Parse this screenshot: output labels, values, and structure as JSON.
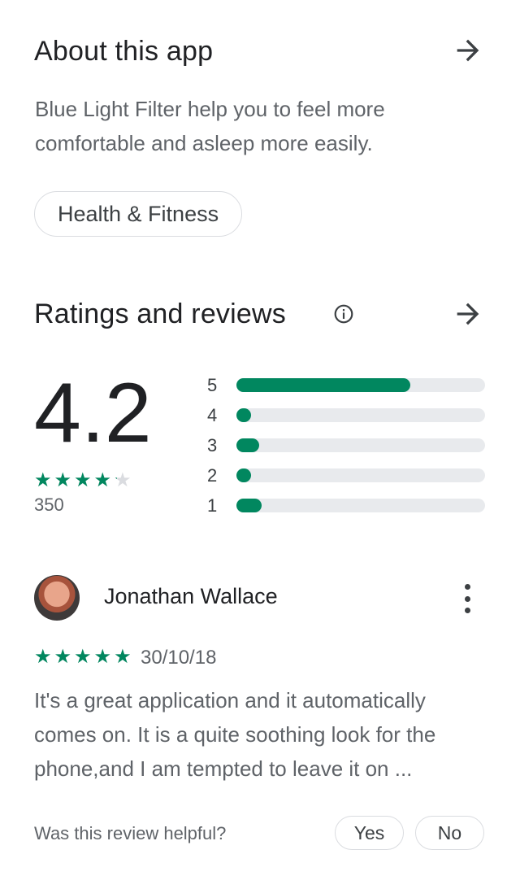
{
  "about": {
    "title": "About this app",
    "description": "Blue Light Filter help you to feel more comfortable and asleep more easily.",
    "category_chip": "Health & Fitness",
    "arrow_icon": "arrow-right-icon"
  },
  "ratings": {
    "title": "Ratings and reviews",
    "info_icon": "info-icon",
    "arrow_icon": "arrow-right-icon",
    "average": "4.2",
    "stars_value": 4.2,
    "count": "350",
    "histogram": [
      {
        "label": "5",
        "fraction": 0.7
      },
      {
        "label": "4",
        "fraction": 0.06
      },
      {
        "label": "3",
        "fraction": 0.09
      },
      {
        "label": "2",
        "fraction": 0.06
      },
      {
        "label": "1",
        "fraction": 0.1
      }
    ],
    "accent_color": "#01875f"
  },
  "review": {
    "author": "Jonathan Wallace",
    "rating": 5,
    "date": "30/10/18",
    "text": "It's a great application and it automatically comes on. It is a quite soothing look for the phone,and I am tempted to leave it on ...",
    "helpful_prompt": "Was this review helpful?",
    "yes_label": "Yes",
    "no_label": "No",
    "more_icon": "more-vert-icon"
  }
}
